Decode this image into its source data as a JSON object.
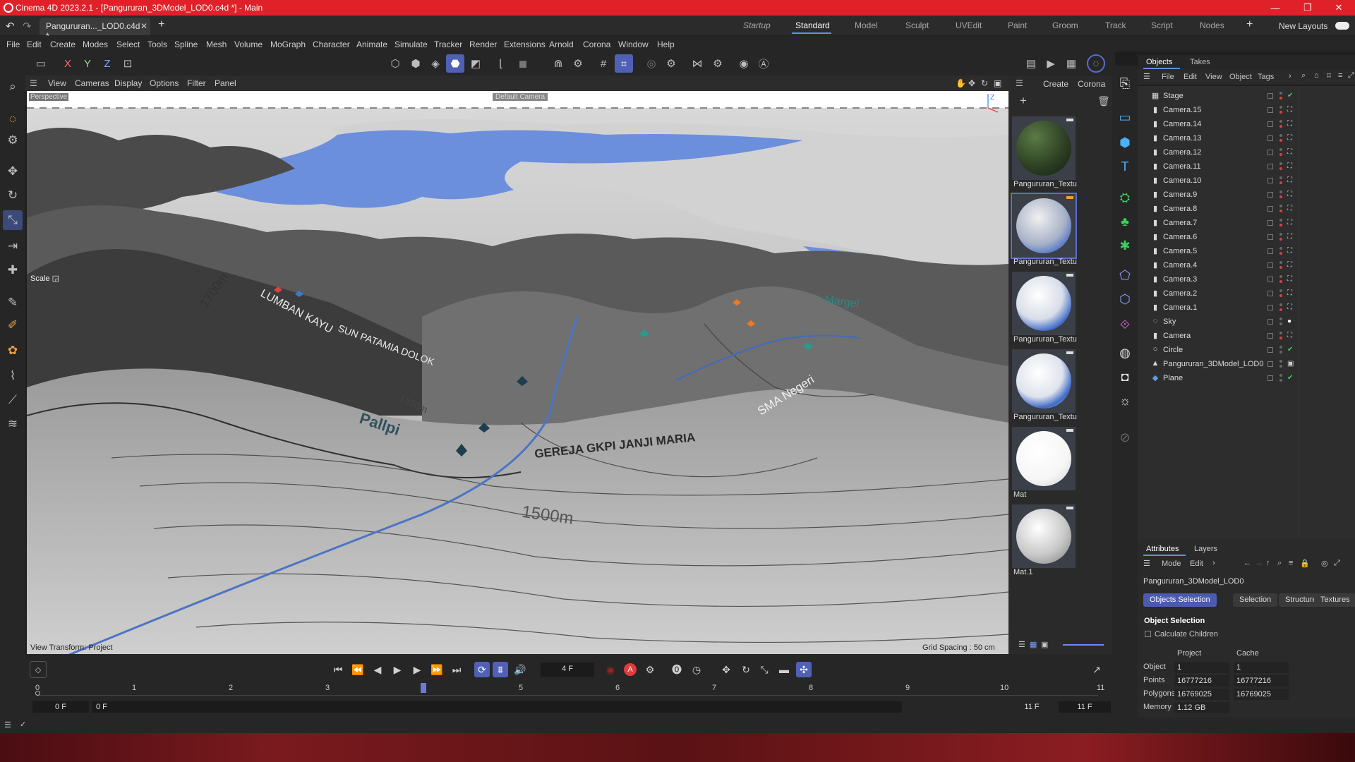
{
  "app": {
    "window_title": "Cinema 4D 2023.2.1 - [Pangururan_3DModel_LOD0.c4d *] - Main",
    "doc_tab": "Pangururan..._LOD0.c4d *",
    "layouts": [
      "Startup",
      "Standard",
      "Model",
      "Sculpt",
      "UVEdit",
      "Paint",
      "Groom",
      "Track",
      "Script",
      "Nodes"
    ],
    "active_layout": "Standard",
    "new_layouts": "New Layouts"
  },
  "menu": [
    "File",
    "Edit",
    "Create",
    "Modes",
    "Select",
    "Tools",
    "Spline",
    "Mesh",
    "Volume",
    "MoGraph",
    "Character",
    "Animate",
    "Simulate",
    "Tracker",
    "Render",
    "Extensions",
    "Arnold",
    "Corona",
    "Window",
    "Help"
  ],
  "toolbar": {
    "axis_x": "X",
    "axis_y": "Y",
    "axis_z": "Z"
  },
  "viewport": {
    "menu": [
      "View",
      "Cameras",
      "Display",
      "Options",
      "Filter",
      "Panel"
    ],
    "label_tl": "Perspective",
    "label_top": "Default Camera",
    "scale_label": "Scale",
    "view_transform": "View Transform: Project",
    "grid_spacing": "Grid Spacing : 50 cm",
    "map_labels": {
      "contour_1500": "1500m",
      "contour_1400": "1400m",
      "contour_1700": "1700m",
      "church": "GEREJA GKPI JANJI MARIA",
      "pallpi": "Pallpi",
      "lumban": "LUMBAN KAYU",
      "sma": "SMA Negeri",
      "margel": "Margel",
      "sun": "SUN PATAMIA DOLOK"
    }
  },
  "material_panel": {
    "menu": [
      "Create",
      "Corona"
    ],
    "materials": [
      {
        "name": "Pangururan_Textu",
        "style": "forest"
      },
      {
        "name": "Pangururan_Textu",
        "style": "map"
      },
      {
        "name": "Pangururan_Textu",
        "style": "map"
      },
      {
        "name": "Pangururan_Textu",
        "style": "map"
      },
      {
        "name": "Mat",
        "style": "white"
      },
      {
        "name": "Mat.1",
        "style": "grey"
      }
    ]
  },
  "objects_panel": {
    "tabs": [
      "Objects",
      "Takes"
    ],
    "menu": [
      "File",
      "Edit",
      "View",
      "Object",
      "Tags"
    ],
    "items": [
      {
        "name": "Stage",
        "icon": "stage-icon",
        "glyph": "▦",
        "tag": "✔"
      },
      {
        "name": "Camera.15",
        "icon": "camera-icon",
        "glyph": "▮",
        "tag": "⛶"
      },
      {
        "name": "Camera.14",
        "icon": "camera-icon",
        "glyph": "▮",
        "tag": "⛶"
      },
      {
        "name": "Camera.13",
        "icon": "camera-icon",
        "glyph": "▮",
        "tag": "⛶"
      },
      {
        "name": "Camera.12",
        "icon": "camera-icon",
        "glyph": "▮",
        "tag": "⛶"
      },
      {
        "name": "Camera.11",
        "icon": "camera-icon",
        "glyph": "▮",
        "tag": "⛶"
      },
      {
        "name": "Camera.10",
        "icon": "camera-icon",
        "glyph": "▮",
        "tag": "⛶"
      },
      {
        "name": "Camera.9",
        "icon": "camera-icon",
        "glyph": "▮",
        "tag": "⛶"
      },
      {
        "name": "Camera.8",
        "icon": "camera-icon",
        "glyph": "▮",
        "tag": "⛶"
      },
      {
        "name": "Camera.7",
        "icon": "camera-icon",
        "glyph": "▮",
        "tag": "⛶"
      },
      {
        "name": "Camera.6",
        "icon": "camera-icon",
        "glyph": "▮",
        "tag": "⛶"
      },
      {
        "name": "Camera.5",
        "icon": "camera-icon",
        "glyph": "▮",
        "tag": "⛶"
      },
      {
        "name": "Camera.4",
        "icon": "camera-icon",
        "glyph": "▮",
        "tag": "⛶"
      },
      {
        "name": "Camera.3",
        "icon": "camera-icon",
        "glyph": "▮",
        "tag": "⛶"
      },
      {
        "name": "Camera.2",
        "icon": "camera-icon",
        "glyph": "▮",
        "tag": "⛶"
      },
      {
        "name": "Camera.1",
        "icon": "camera-icon",
        "glyph": "▮",
        "tag": "⛶"
      },
      {
        "name": "Sky",
        "icon": "sky-icon",
        "glyph": "◌",
        "tag": "●"
      },
      {
        "name": "Camera",
        "icon": "camera-icon",
        "glyph": "▮",
        "tag": "⛶"
      },
      {
        "name": "Circle",
        "icon": "circle-spline-icon",
        "glyph": "○",
        "tag": "✔"
      },
      {
        "name": "Pangururan_3DModel_LOD0",
        "icon": "polygon-object-icon",
        "glyph": "▲",
        "tag": "▣"
      },
      {
        "name": "Plane",
        "icon": "plane-icon",
        "glyph": "◆",
        "tag": "✔"
      }
    ]
  },
  "attributes": {
    "tabs": [
      "Attributes",
      "Layers"
    ],
    "menu": [
      "Mode",
      "Edit"
    ],
    "object_name": "Pangururan_3DModel_LOD0",
    "buttons": [
      "Objects Selection",
      "Selection",
      "Structure",
      "Textures"
    ],
    "section": "Object Selection",
    "calc_children": "Calculate Children",
    "col_project": "Project",
    "col_cache": "Cache",
    "rows": [
      {
        "label": "Object",
        "project": "1",
        "cache": "1"
      },
      {
        "label": "Points",
        "project": "16777216",
        "cache": "16777216"
      },
      {
        "label": "Polygons",
        "project": "16769025",
        "cache": "16769025"
      },
      {
        "label": "Memory",
        "project": "1.12 GB",
        "cache": ""
      }
    ]
  },
  "timeline": {
    "current_frame": "4 F",
    "ticks": [
      "0",
      "1",
      "2",
      "3",
      "4",
      "5",
      "6",
      "7",
      "8",
      "9",
      "10",
      "11"
    ],
    "current_position_frame": 4,
    "start_a": "0 F",
    "start_b": "0 F",
    "end_a": "11 F",
    "end_b": "11 F"
  }
}
